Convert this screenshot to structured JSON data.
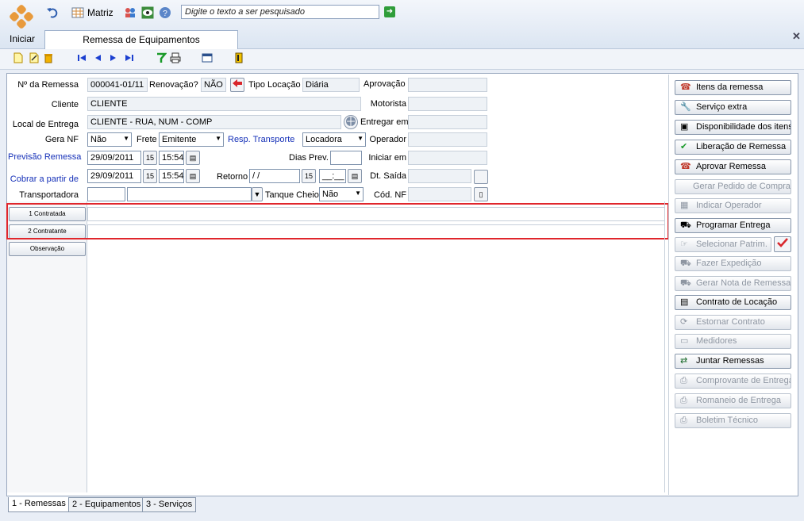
{
  "toolbar": {
    "iniciar": "Iniciar",
    "matriz": "Matriz",
    "search_placeholder": "Digite o texto a ser pesquisado"
  },
  "tab_title": "Remessa de Equipamentos",
  "form": {
    "nr_remessa_label": "Nº da Remessa",
    "nr_remessa": "000041-01/11",
    "renovacao_label": "Renovação?",
    "renovacao": "NÃO",
    "tipo_locacao_label": "Tipo Locação",
    "tipo_locacao": "Diária",
    "aprovacao_label": "Aprovação",
    "cliente_label": "Cliente",
    "cliente": "CLIENTE",
    "motorista_label": "Motorista",
    "local_entrega_label": "Local de Entrega",
    "local_entrega": "CLIENTE - RUA, NUM - COMP",
    "entregar_em_label": "Entregar em",
    "gera_nf_label": "Gera NF",
    "gera_nf": "Não",
    "frete_label": "Frete",
    "frete": "Emitente",
    "resp_transporte_label": "Resp. Transporte",
    "resp_transporte": "Locadora",
    "operador_label": "Operador",
    "previsao_label": "Previsão Remessa",
    "previsao_data": "29/09/2011",
    "previsao_hora": "15:54",
    "dias_prev_label": "Dias Prev.",
    "iniciar_em_label": "Iniciar em",
    "cobrar_label": "Cobrar a partir de",
    "cobrar_data": "29/09/2011",
    "cobrar_hora": "15:54",
    "retorno_label": "Retorno",
    "retorno_data": " / /",
    "retorno_hora": "__:__",
    "dt_saida_label": "Dt. Saída",
    "transportadora_label": "Transportadora",
    "tanque_cheio_label": "Tanque Cheio",
    "tanque_cheio": "Não",
    "cod_nf_label": "Cód. NF"
  },
  "sub_buttons": {
    "contratada": "1 Contratada",
    "contratante": "2 Contratante",
    "observacao": "Observação"
  },
  "right_buttons": [
    {
      "label": "Itens da remessa",
      "icon": "phone-icon",
      "enabled": true
    },
    {
      "label": "Serviço extra",
      "icon": "wrench-icon",
      "enabled": true
    },
    {
      "label": "Disponibilidade dos itens",
      "icon": "clipboard-icon",
      "enabled": true
    },
    {
      "label": "Liberação de Remessa",
      "icon": "check-icon",
      "enabled": true
    },
    {
      "label": "Aprovar Remessa",
      "icon": "phone-icon",
      "enabled": true
    },
    {
      "label": "Gerar Pedido de Compra",
      "icon": "",
      "enabled": false
    },
    {
      "label": "Indicar Operador",
      "icon": "grid-icon",
      "enabled": false
    },
    {
      "label": "Programar Entrega",
      "icon": "truck-icon",
      "enabled": true
    },
    {
      "label": "Selecionar Patrim.",
      "icon": "pointer-icon",
      "enabled": false
    },
    {
      "label": "Fazer Expedição",
      "icon": "truck-icon",
      "enabled": false
    },
    {
      "label": "Gerar Nota de Remessa",
      "icon": "truck-icon",
      "enabled": false
    },
    {
      "label": "Contrato de Locação",
      "icon": "contract-icon",
      "enabled": true
    },
    {
      "label": "Estornar Contrato",
      "icon": "refresh-icon",
      "enabled": false
    },
    {
      "label": "Medidores",
      "icon": "meter-icon",
      "enabled": false
    },
    {
      "label": "Juntar Remessas",
      "icon": "merge-icon",
      "enabled": true
    },
    {
      "label": "Comprovante de Entrega",
      "icon": "printer-icon",
      "enabled": false
    },
    {
      "label": "Romaneio de Entrega",
      "icon": "printer-icon",
      "enabled": false
    },
    {
      "label": "Boletim Técnico",
      "icon": "printer-icon",
      "enabled": false
    }
  ],
  "bottom_tabs": [
    "1 - Remessas",
    "2 - Equipamentos",
    "3 - Serviços"
  ],
  "colors": {
    "highlight": "#e0262c",
    "link_blue": "#1530b8"
  }
}
